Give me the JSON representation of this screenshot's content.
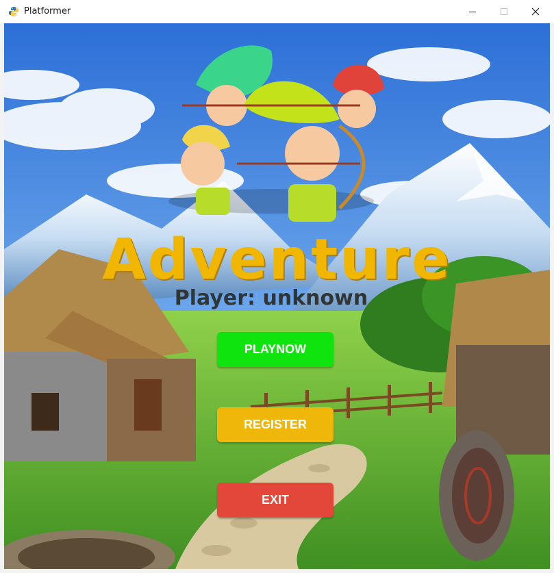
{
  "window": {
    "title": "Platformer",
    "icons": {
      "app": "python-icon",
      "minimize": "minimize-icon",
      "maximize": "maximize-icon",
      "close": "close-icon"
    }
  },
  "game": {
    "title": "Adventure",
    "player_label": "Player: unknown",
    "buttons": {
      "play": "PLAYNOW",
      "register": "REGISTER",
      "exit": "EXIT"
    },
    "colors": {
      "title": "#f1b600",
      "play": "#10e40e",
      "register": "#efb709",
      "exit": "#e2473a",
      "player_text": "#303536"
    }
  }
}
